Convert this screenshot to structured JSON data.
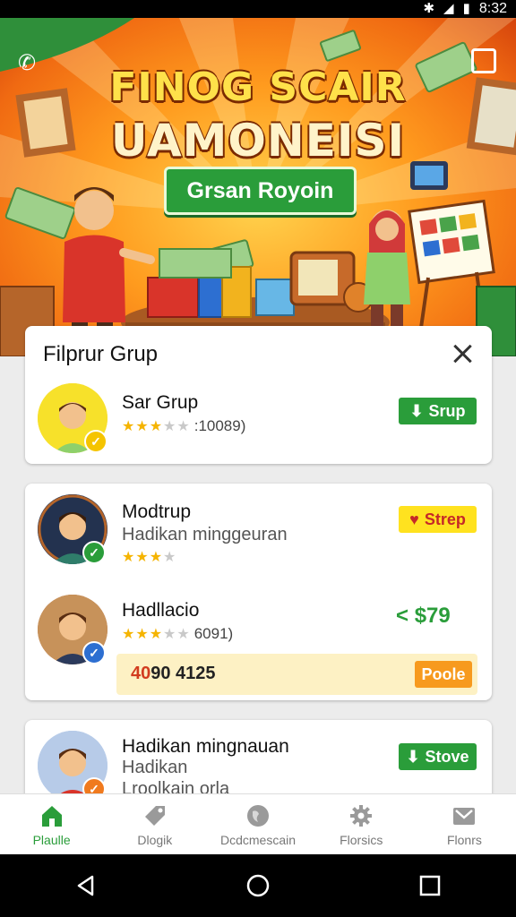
{
  "status_bar": {
    "time": "8:32",
    "icons": [
      "bluetooth-icon",
      "wifi-icon",
      "battery-icon"
    ]
  },
  "banner": {
    "title_line1": "FINOG SCAIR",
    "title_line2": "UAMONEISI",
    "cta_label": "Grsan Royoin",
    "colors": {
      "title": "#ffe14a",
      "cta": "#2a9d3a"
    }
  },
  "card1": {
    "title": "Filprur Grup",
    "close_icon": "close-icon",
    "row": {
      "name": "Sar Grup",
      "rating": 2.5,
      "rating_count": ":10089)",
      "action_label": "Srup",
      "action_icon": "arrow-down-icon"
    }
  },
  "card2": {
    "rows": [
      {
        "name": "Modtrup",
        "subtitle": "Hadikan minggeuran",
        "rating": 3,
        "action_label": "Strep",
        "action_icon": "heart-icon"
      },
      {
        "name": "Hadllacio",
        "rating": 2.5,
        "rating_count": "6091)",
        "price": "$79",
        "price_icon": "share-icon"
      }
    ],
    "promo": {
      "code_part1": "40",
      "code_part2": "90 4125",
      "button_label": "Poole"
    }
  },
  "card3": {
    "row": {
      "name": "Hadikan mingnauan",
      "subtitle": "Hadikan",
      "subtitle2": "Lroolkain orla",
      "action_label": "Stove",
      "action_icon": "arrow-down-icon"
    }
  },
  "bottom_nav": {
    "items": [
      {
        "label": "Plaulle",
        "icon": "home-icon",
        "active": true
      },
      {
        "label": "Dlogik",
        "icon": "tag-icon",
        "active": false
      },
      {
        "label": "Dcdcmescain",
        "icon": "globe-icon",
        "active": false
      },
      {
        "label": "Florsics",
        "icon": "gear-icon",
        "active": false
      },
      {
        "label": "Flonrs",
        "icon": "mail-icon",
        "active": false
      }
    ]
  },
  "system_nav": {
    "items": [
      "back-icon",
      "home-circle-icon",
      "recents-icon"
    ]
  }
}
